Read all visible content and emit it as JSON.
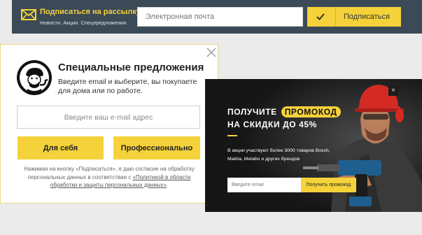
{
  "newsletter": {
    "title": "Подписаться на рассылку:",
    "subtitle": "Новости. Акции. Спецпредложения.",
    "email_placeholder": "Электронная почта",
    "button_label": "Подписаться",
    "envelope_icon": "envelope-icon",
    "check_icon": "checkmark-icon"
  },
  "offers_popup": {
    "title": "Специальные предложения",
    "description": "Введите email и выберите, вы покупаете для дома или по работе.",
    "email_placeholder": "Введите ваш e-mail адрес",
    "personal_button": "Для себя",
    "professional_button": "Профессионально",
    "consent_text": "Нажимая на кнопку «Подписаться», я даю согласие на обработку персональных данных в соответствии с ",
    "consent_link": "«Политикой в области обработки и защиты персональных данных»",
    "consent_end": ".",
    "logo_icon": "mascot-logo-icon",
    "close_icon": "close-icon"
  },
  "promo": {
    "headline_prefix": "ПОЛУЧИТЕ",
    "headline_highlight": "ПРОМОКОД",
    "headline_line2": "НА СКИДКИ ДО 45%",
    "text": "В акции участвуют более 3000 товаров Bosch, Makita, Metabo и других брендов",
    "email_placeholder": "Введите email",
    "button_label": "Получить промокод",
    "close_label": "×",
    "photo_icon": "worker-with-drill-photo"
  },
  "colors": {
    "accent": "#f5d23a",
    "bar_background": "#3b4a56",
    "promo_background": "#161616"
  }
}
